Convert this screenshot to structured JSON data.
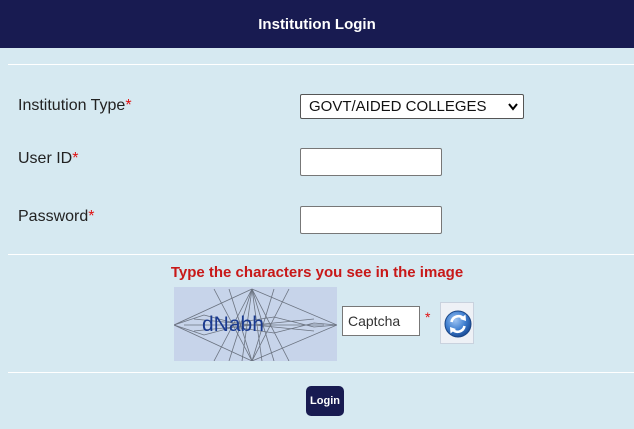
{
  "header": {
    "title": "Institution Login"
  },
  "form": {
    "institution_type_label": "Institution Type",
    "institution_type_value": "GOVT/AIDED COLLEGES",
    "user_id_label": "User ID",
    "password_label": "Password",
    "required_marker": "*",
    "user_id_value": "",
    "password_value": ""
  },
  "captcha": {
    "instruction": "Type the characters you see in the image",
    "image_text": "dNabh",
    "input_placeholder": "Captcha",
    "required_marker": "*"
  },
  "buttons": {
    "login_label": "Login"
  },
  "icons": {
    "refresh": "refresh-icon",
    "dropdown": "chevron-down-icon"
  },
  "colors": {
    "header_bg": "#181b51",
    "page_bg": "#d6e9f1",
    "required": "#e01010",
    "captcha_instruction": "#c81818"
  }
}
